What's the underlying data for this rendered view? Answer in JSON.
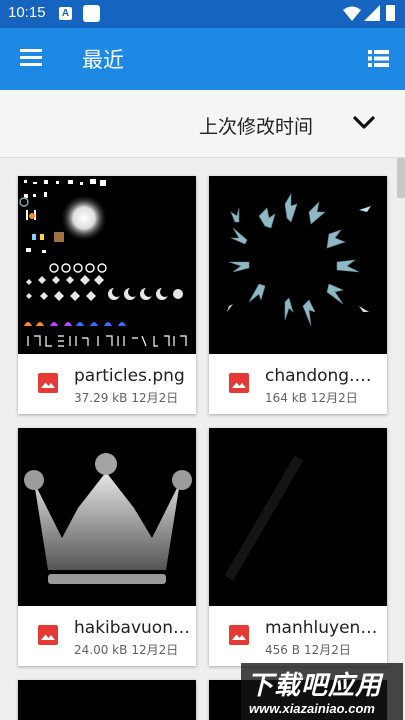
{
  "status_bar": {
    "time": "10:15",
    "notification_letter": "A"
  },
  "app_bar": {
    "title": "最近"
  },
  "sort": {
    "label": "上次修改时间"
  },
  "files": [
    {
      "name": "particles.png",
      "size": "37.29 kB",
      "date": "12月2日"
    },
    {
      "name": "chandong.png",
      "size": "164 kB",
      "date": "12月2日"
    },
    {
      "name": "hakibavuong.png",
      "size": "24.00 kB",
      "date": "12月2日"
    },
    {
      "name": "manhluyen.png",
      "size": "456 B",
      "date": "12月2日"
    }
  ],
  "icons": {
    "menu": "hamburger-menu-icon",
    "view": "list-view-icon",
    "sort": "chevron-down-icon",
    "file": "image-file-icon"
  },
  "colors": {
    "status_bar": "#1565c0",
    "app_bar": "#1e88e5",
    "file_icon": "#e53935"
  },
  "watermark": {
    "title": "下载吧应用",
    "url": "www.xiazainiao.com"
  }
}
